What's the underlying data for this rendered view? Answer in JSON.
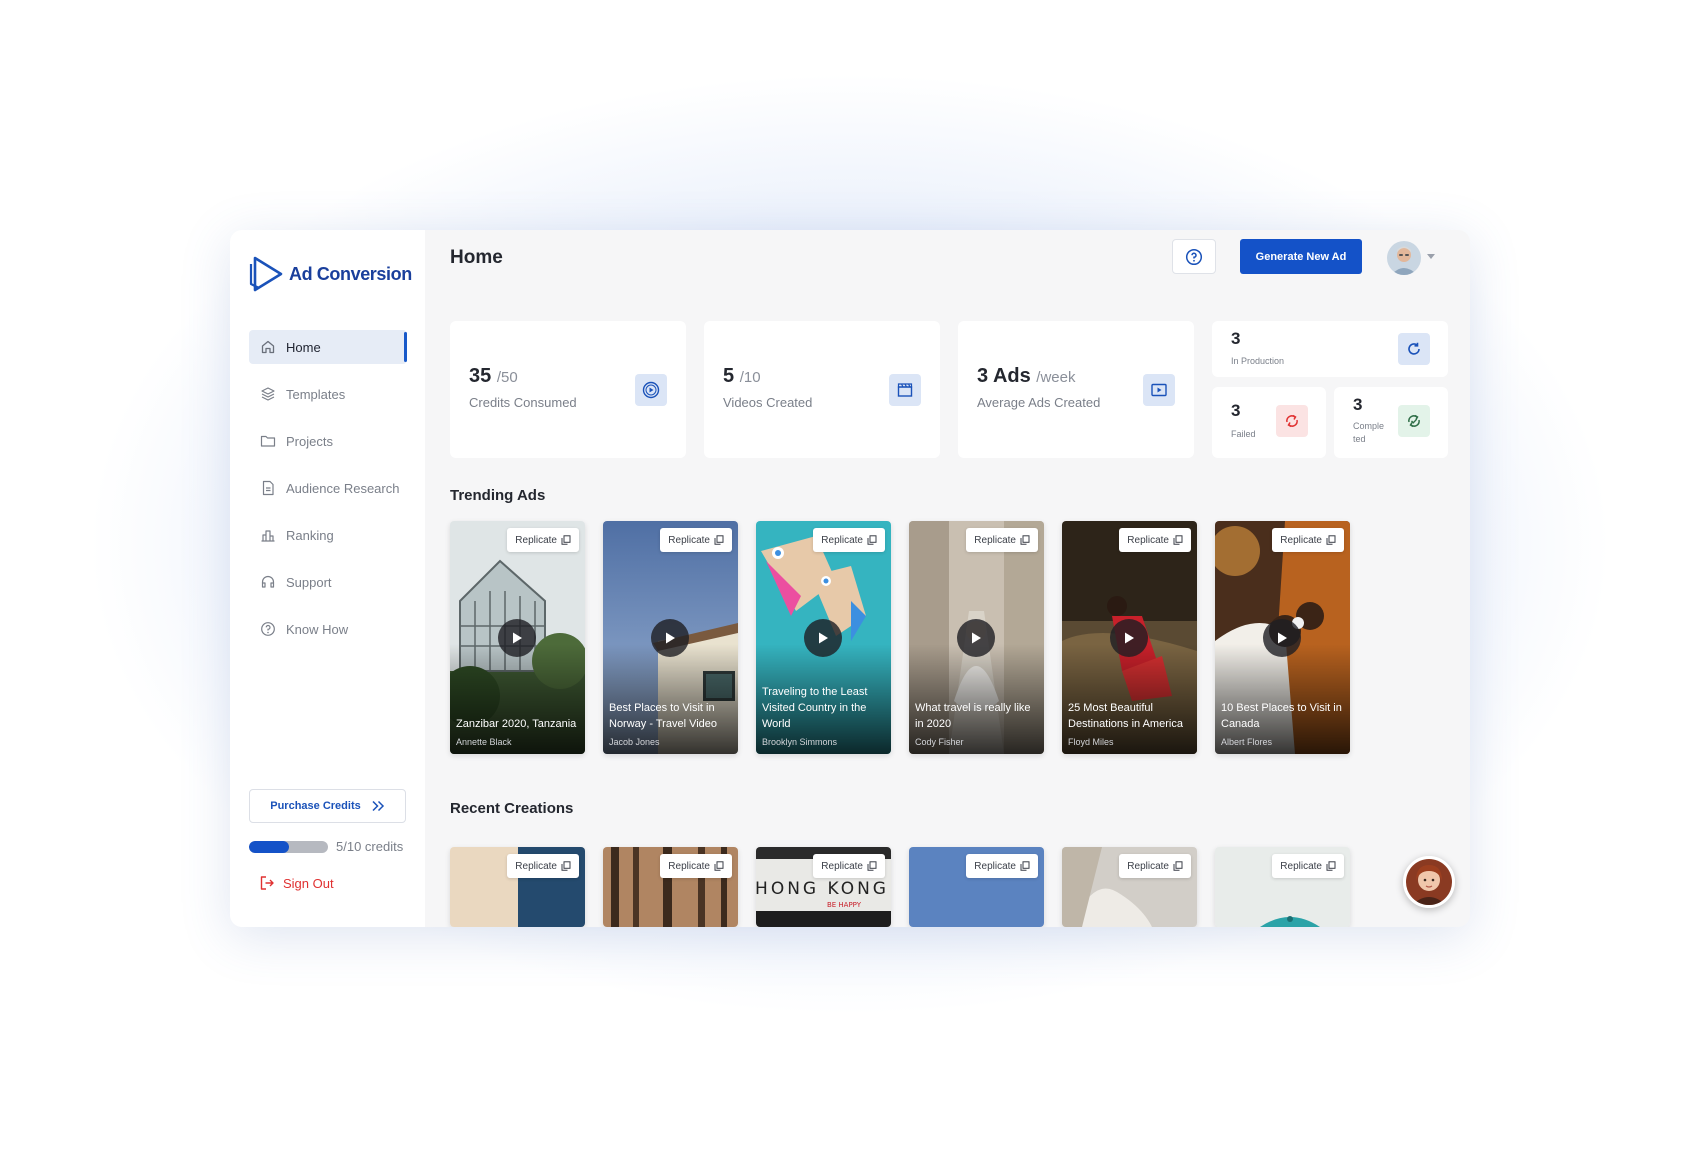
{
  "app": {
    "logo_text": "Ad Conversion",
    "brand_color": "#1452c8"
  },
  "sidebar": {
    "items": [
      {
        "label": "Home",
        "icon": "home-icon",
        "active": true
      },
      {
        "label": "Templates",
        "icon": "layers-icon"
      },
      {
        "label": "Projects",
        "icon": "folder-icon"
      },
      {
        "label": "Audience Research",
        "icon": "document-icon"
      },
      {
        "label": "Ranking",
        "icon": "bar-chart-icon"
      },
      {
        "label": "Support",
        "icon": "headset-icon"
      },
      {
        "label": "Know How",
        "icon": "question-icon"
      }
    ],
    "purchase_label": "Purchase Credits",
    "credits_text": "5/10 credits",
    "credits_fraction": 0.5,
    "sign_out": "Sign Out"
  },
  "header": {
    "title": "Home",
    "generate_label": "Generate New Ad"
  },
  "stats": [
    {
      "value": "35",
      "suffix": "/50",
      "label": "Credits Consumed",
      "icon": "credits-icon"
    },
    {
      "value": "5",
      "suffix": "/10",
      "label": "Videos Created",
      "icon": "clapper-icon"
    },
    {
      "value": "3 Ads",
      "suffix": "/week",
      "label": "Average Ads Created",
      "icon": "video-play-icon"
    }
  ],
  "status": {
    "production": {
      "value": "3",
      "label": "In Production"
    },
    "failed": {
      "value": "3",
      "label": "Failed"
    },
    "completed": {
      "value": "3",
      "label": "Comple\nted"
    }
  },
  "trending": {
    "title": "Trending Ads",
    "replicate_label": "Replicate",
    "cards": [
      {
        "title": "Zanzibar 2020, Tanzania",
        "author": "Annette Black"
      },
      {
        "title": "Best Places to Visit in Norway - Travel Video",
        "author": "Jacob Jones"
      },
      {
        "title": "Traveling to the Least Visited Country in the World",
        "author": "Brooklyn Simmons"
      },
      {
        "title": "What travel is really like in 2020",
        "author": "Cody Fisher"
      },
      {
        "title": "25 Most Beautiful Destinations in America",
        "author": "Floyd Miles"
      },
      {
        "title": "10 Best Places to Visit in Canada",
        "author": "Albert Flores"
      }
    ]
  },
  "recent": {
    "title": "Recent Creations",
    "replicate_label": "Replicate",
    "hong_kong_sign": "HONG KONG",
    "hong_kong_sub": "BE HAPPY"
  }
}
